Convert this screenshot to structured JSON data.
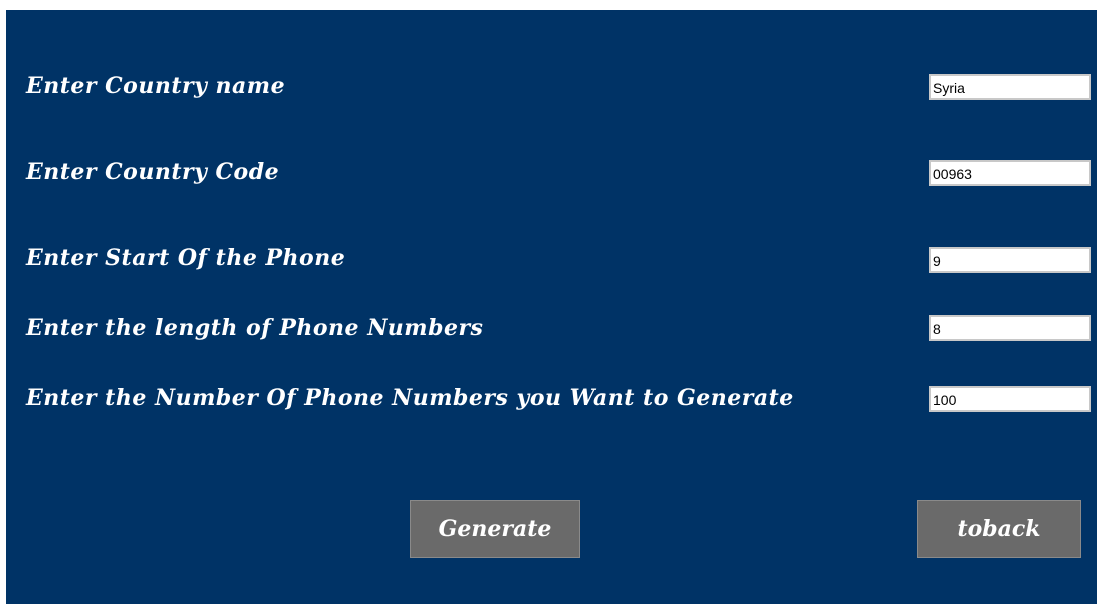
{
  "form": {
    "fields": [
      {
        "label": "Enter Country name",
        "value": "Syria"
      },
      {
        "label": "Enter Country Code",
        "value": "00963"
      },
      {
        "label": "Enter Start Of the Phone",
        "value": "9"
      },
      {
        "label": "Enter the length of Phone Numbers",
        "value": "8"
      },
      {
        "label": "Enter the Number Of Phone Numbers you Want to Generate",
        "value": "100"
      }
    ]
  },
  "buttons": {
    "generate_label": "Generate",
    "back_label": "toback"
  },
  "colors": {
    "background": "#003366",
    "button": "#6a6a6a",
    "text": "#ffffff"
  }
}
